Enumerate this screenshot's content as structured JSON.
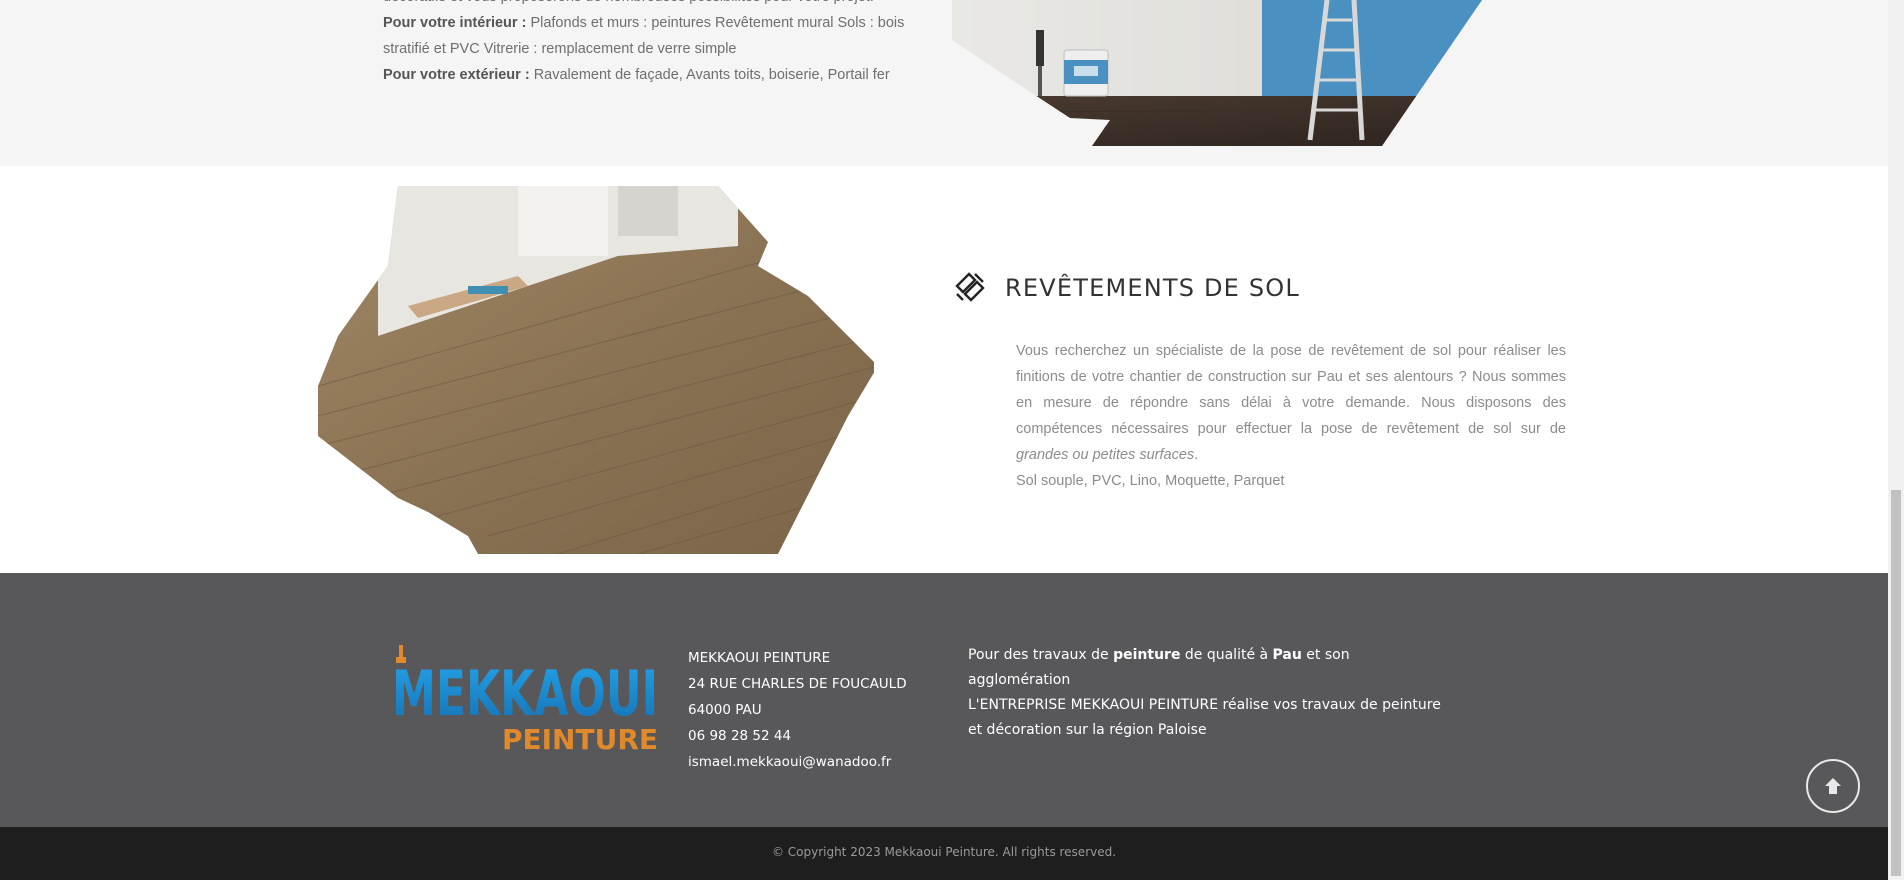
{
  "top_section": {
    "partial_line": "décoratifs et vous proposerons de nombreuses possibilités pour votre projet.",
    "interieur_label": "Pour votre intérieur :",
    "interieur_text": " Plafonds et murs : peintures Revêtement mural Sols : bois stratifié et PVC Vitrerie : remplacement de verre simple",
    "exterieur_label": "Pour votre extérieur :",
    "exterieur_text": " Ravalement de façade, Avants toits, boiserie, Portail fer"
  },
  "revetements": {
    "title": "REVÊTEMENTS DE SOL",
    "icon": "parquet-icon",
    "text_1": "Vous recherchez un spécialiste de la pose de revêtement de sol pour réaliser les finitions de votre chantier de construction sur Pau et ses alentours ? Nous sommes en mesure de répondre sans délai à votre demande. Nous disposons des compétences nécessaires pour effectuer la pose de revêtement de sol sur de ",
    "text_emphasis": "grandes ou petites surfaces",
    "text_end": ".",
    "list_line": "Sol souple, PVC, Lino, Moquette, Parquet"
  },
  "footer": {
    "logo_top": "MEKKAOUI",
    "logo_bottom": "PEINTURE",
    "company": "MEKKAOUI PEINTURE",
    "street": "24 RUE CHARLES DE FOUCAULD",
    "city": "64000 PAU",
    "phone": "06 98 28 52 44",
    "email": "ismael.mekkaoui@wanadoo.fr",
    "about_1": "Pour des travaux de ",
    "about_peinture": "peinture",
    "about_2": " de qualité à ",
    "about_pau": "Pau",
    "about_3": " et son agglomération",
    "about_4": "L'ENTREPRISE MEKKAOUI PEINTURE réalise vos travaux de peinture et décoration sur la région Paloise",
    "copyright": "© Copyright 2023 Mekkaoui Peinture. All rights reserved."
  },
  "colors": {
    "footer_bg": "#58585a",
    "copyright_bg": "#1e1e1e",
    "logo_blue": "#1b8fd6",
    "logo_orange": "#e08a2c",
    "wall_blue": "#4a90c0"
  },
  "icons": {
    "back_to_top": "arrow-up-icon"
  }
}
